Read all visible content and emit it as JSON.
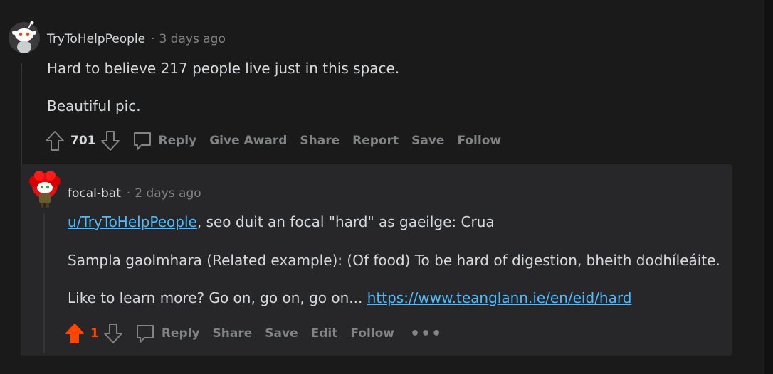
{
  "comments": [
    {
      "author": "TryToHelpPeople",
      "separator": "·",
      "time": "3 days ago",
      "body": [
        "Hard to believe 217 people live just in this space.",
        "Beautiful pic."
      ],
      "score": "701",
      "actions": [
        "Reply",
        "Give Award",
        "Share",
        "Report",
        "Save",
        "Follow"
      ],
      "upvoted": false
    },
    {
      "author": "focal-bat",
      "separator": "·",
      "time": "2 days ago",
      "mention": "u/TryToHelpPeople",
      "line1_rest": ", seo duit an focal \"hard\" as gaeilge: Crua",
      "line2": "Sampla gaolmhara (Related example): (Of food) To be hard of digestion, bheith dodhíleáite.",
      "line3_prefix": "Like to learn more? Go on, go on, go on... ",
      "link": "https://www.teanglann.ie/en/eid/hard",
      "score": "1",
      "actions": [
        "Reply",
        "Share",
        "Save",
        "Edit",
        "Follow"
      ],
      "more": "•••",
      "upvoted": true
    }
  ],
  "colors": {
    "background": "#1a1a1b",
    "reply_background": "#272729",
    "upvote": "#ff4500",
    "link": "#4fbcff",
    "muted": "#818384"
  },
  "icons": [
    "snoo-avatar-icon",
    "upvote-icon",
    "downvote-icon",
    "comment-icon",
    "more-options-icon"
  ]
}
